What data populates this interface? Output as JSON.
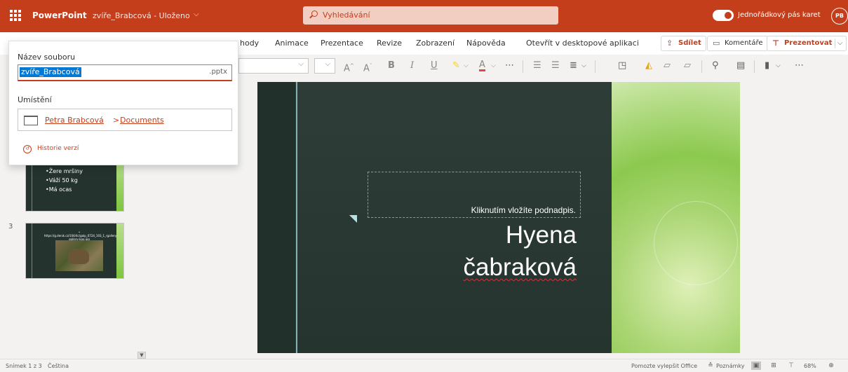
{
  "titlebar": {
    "app_name": "PowerPoint",
    "doc_name": "zvíře_Brabcová - Uloženo",
    "search_placeholder": "Vyhledávání",
    "ribbon_toggle_label": "Jednořádkový pás karet",
    "avatar_initials": "PB",
    "accent_color": "#c43e1c"
  },
  "ribbon": {
    "tabs": [
      "hody",
      "Animace",
      "Prezentace",
      "Revize",
      "Zobrazení",
      "Nápověda",
      "Otevřít v desktopové aplikaci"
    ],
    "share_label": "Sdílet",
    "comments_label": "Komentáře",
    "present_label": "Prezentovat"
  },
  "file_panel": {
    "name_label": "Název souboru",
    "file_name": "zvíře_Brabcová",
    "extension": ".pptx",
    "location_label": "Umístění",
    "location_user": "Petra Brabcová",
    "location_separator": ">",
    "location_folder": "Documents",
    "history_label": "Historie verzí"
  },
  "thumbnails": {
    "slide2_bullets": [
      "•Žere mršiny",
      "•Váží 50 kg",
      "•Má ocas"
    ],
    "slide3_number": "3",
    "slide3_link": "• https://g.denik.cz/104/4c/galp_0724_103_1_rgallery-gallery-kpo.jpg"
  },
  "slide": {
    "subtitle_placeholder": "Kliknutím vložíte podnadpis.",
    "title_line1": "Hyena",
    "title_line2": "čabraková"
  },
  "statusbar": {
    "slide_counter": "Snímek 1 z 3",
    "language": "Čeština",
    "feedback": "Pomozte vylepšit Office",
    "notes_label": "Poznámky",
    "zoom": "68%"
  }
}
